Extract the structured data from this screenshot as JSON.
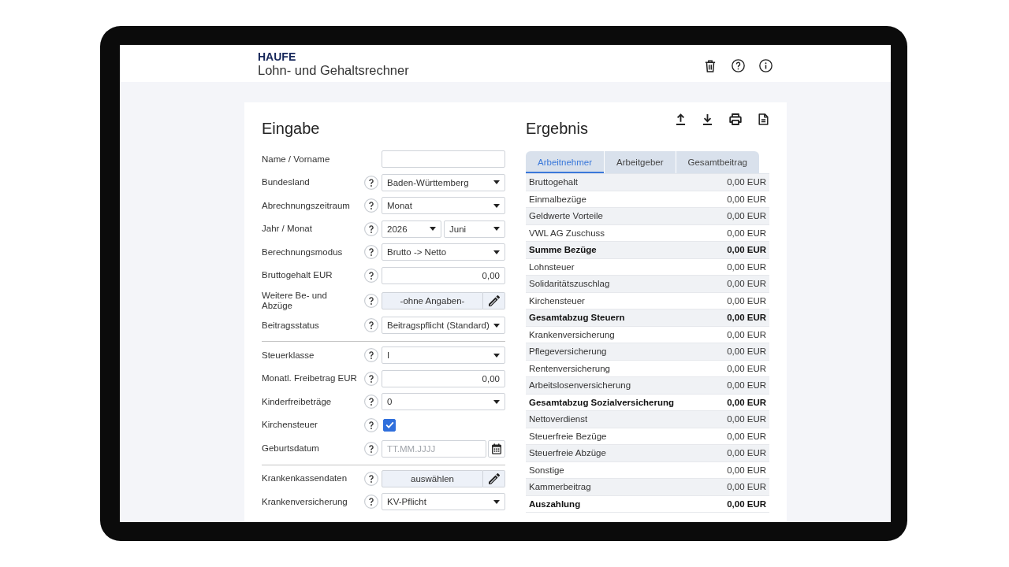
{
  "header": {
    "brand": "HAUFE",
    "title": "Lohn- und Gehaltsrechner"
  },
  "input": {
    "title": "Eingabe",
    "groups": [
      {
        "rows": [
          {
            "kind": "text",
            "label": "Name / Vorname",
            "help": false
          },
          {
            "kind": "select",
            "label": "Bundesland",
            "help": true,
            "value": "Baden-Württemberg"
          },
          {
            "kind": "select",
            "label": "Abrechnungszeitraum",
            "help": true,
            "value": "Monat"
          },
          {
            "kind": "select_pair",
            "label": "Jahr / Monat",
            "help": true,
            "values": [
              "2026",
              "Juni"
            ]
          },
          {
            "kind": "select",
            "label": "Berechnungsmodus",
            "help": true,
            "value": "Brutto -> Netto"
          },
          {
            "kind": "number",
            "label": "Bruttogehalt EUR",
            "help": true,
            "value": "0,00"
          },
          {
            "kind": "button",
            "label": "Weitere Be- und Abzüge",
            "help": true,
            "value": "-ohne Angaben-"
          },
          {
            "kind": "select",
            "label": "Beitragsstatus",
            "help": true,
            "value": "Beitragspflicht (Standard)"
          }
        ]
      },
      {
        "rows": [
          {
            "kind": "select",
            "label": "Steuerklasse",
            "help": true,
            "value": "I"
          },
          {
            "kind": "number",
            "label": "Monatl. Freibetrag EUR",
            "help": true,
            "value": "0,00"
          },
          {
            "kind": "select",
            "label": "Kinderfreibeträge",
            "help": true,
            "value": "0"
          },
          {
            "kind": "checkbox",
            "label": "Kirchensteuer",
            "help": true,
            "checked": true
          },
          {
            "kind": "date",
            "label": "Geburtsdatum",
            "help": true,
            "placeholder": "TT.MM.JJJJ"
          }
        ]
      },
      {
        "rows": [
          {
            "kind": "button",
            "label": "Krankenkassendaten",
            "help": true,
            "value": "auswählen"
          },
          {
            "kind": "select",
            "label": "Krankenversicherung",
            "help": true,
            "value": "KV-Pflicht"
          }
        ]
      }
    ]
  },
  "result": {
    "title": "Ergebnis",
    "tabs": [
      {
        "label": "Arbeitnehmer",
        "selected": true
      },
      {
        "label": "Arbeitgeber",
        "selected": false
      },
      {
        "label": "Gesamtbeitrag",
        "selected": false
      }
    ],
    "rows": [
      {
        "label": "Bruttogehalt",
        "value": "0,00 EUR",
        "bold": false
      },
      {
        "label": "Einmalbezüge",
        "value": "0,00 EUR",
        "bold": false
      },
      {
        "label": "Geldwerte Vorteile",
        "value": "0,00 EUR",
        "bold": false
      },
      {
        "label": "VWL AG Zuschuss",
        "value": "0,00 EUR",
        "bold": false
      },
      {
        "label": "Summe Bezüge",
        "value": "0,00 EUR",
        "bold": true
      },
      {
        "label": "Lohnsteuer",
        "value": "0,00 EUR",
        "bold": false
      },
      {
        "label": "Solidaritätszuschlag",
        "value": "0,00 EUR",
        "bold": false
      },
      {
        "label": "Kirchensteuer",
        "value": "0,00 EUR",
        "bold": false
      },
      {
        "label": "Gesamtabzug Steuern",
        "value": "0,00 EUR",
        "bold": true
      },
      {
        "label": "Krankenversicherung",
        "value": "0,00 EUR",
        "bold": false
      },
      {
        "label": "Pflegeversicherung",
        "value": "0,00 EUR",
        "bold": false
      },
      {
        "label": "Rentenversicherung",
        "value": "0,00 EUR",
        "bold": false
      },
      {
        "label": "Arbeitslosenversicherung",
        "value": "0,00 EUR",
        "bold": false
      },
      {
        "label": "Gesamtabzug Sozialversicherung",
        "value": "0,00 EUR",
        "bold": true
      },
      {
        "label": "Nettoverdienst",
        "value": "0,00 EUR",
        "bold": false
      },
      {
        "label": "Steuerfreie Bezüge",
        "value": "0,00 EUR",
        "bold": false
      },
      {
        "label": "Steuerfreie Abzüge",
        "value": "0,00 EUR",
        "bold": false
      },
      {
        "label": "Sonstige",
        "value": "0,00 EUR",
        "bold": false
      },
      {
        "label": "Kammerbeitrag",
        "value": "0,00 EUR",
        "bold": false
      },
      {
        "label": "Auszahlung",
        "value": "0,00 EUR",
        "bold": true
      }
    ]
  }
}
